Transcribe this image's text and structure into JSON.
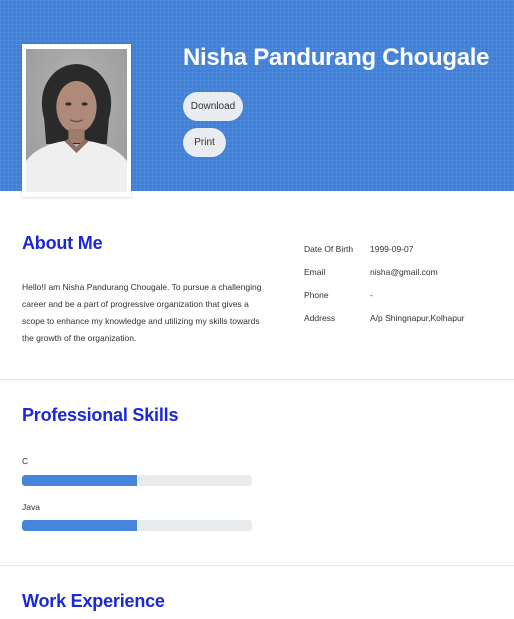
{
  "profile": {
    "name": "Nisha Pandurang Chougale",
    "download_label": "Download",
    "print_label": "Print"
  },
  "about": {
    "title": "About Me",
    "text": "Hello!I am Nisha Pandurang Chougale. To pursue a challenging career and be a part of progressive organization that gives a scope to enhance my knowledge and utilizing my skills towards the growth of the organization."
  },
  "info": [
    {
      "label": "Date Of Birth",
      "value": "1999-09-07"
    },
    {
      "label": "Email",
      "value": "nisha@gmail.com"
    },
    {
      "label": "Phone",
      "value": "-"
    },
    {
      "label": "Address",
      "value": "A/p Shingnapur,Kolhapur"
    }
  ],
  "skills": {
    "title": "Professional Skills",
    "items": [
      {
        "name": "C",
        "level": 0.5
      },
      {
        "name": "Java",
        "level": 0.5
      }
    ]
  },
  "work": {
    "title": "Work Experience"
  },
  "colors": {
    "hero_bg": "#3f80d9",
    "heading": "#1c28d6",
    "skill_fill": "#4586dc",
    "skill_track": "#e9ecef"
  }
}
